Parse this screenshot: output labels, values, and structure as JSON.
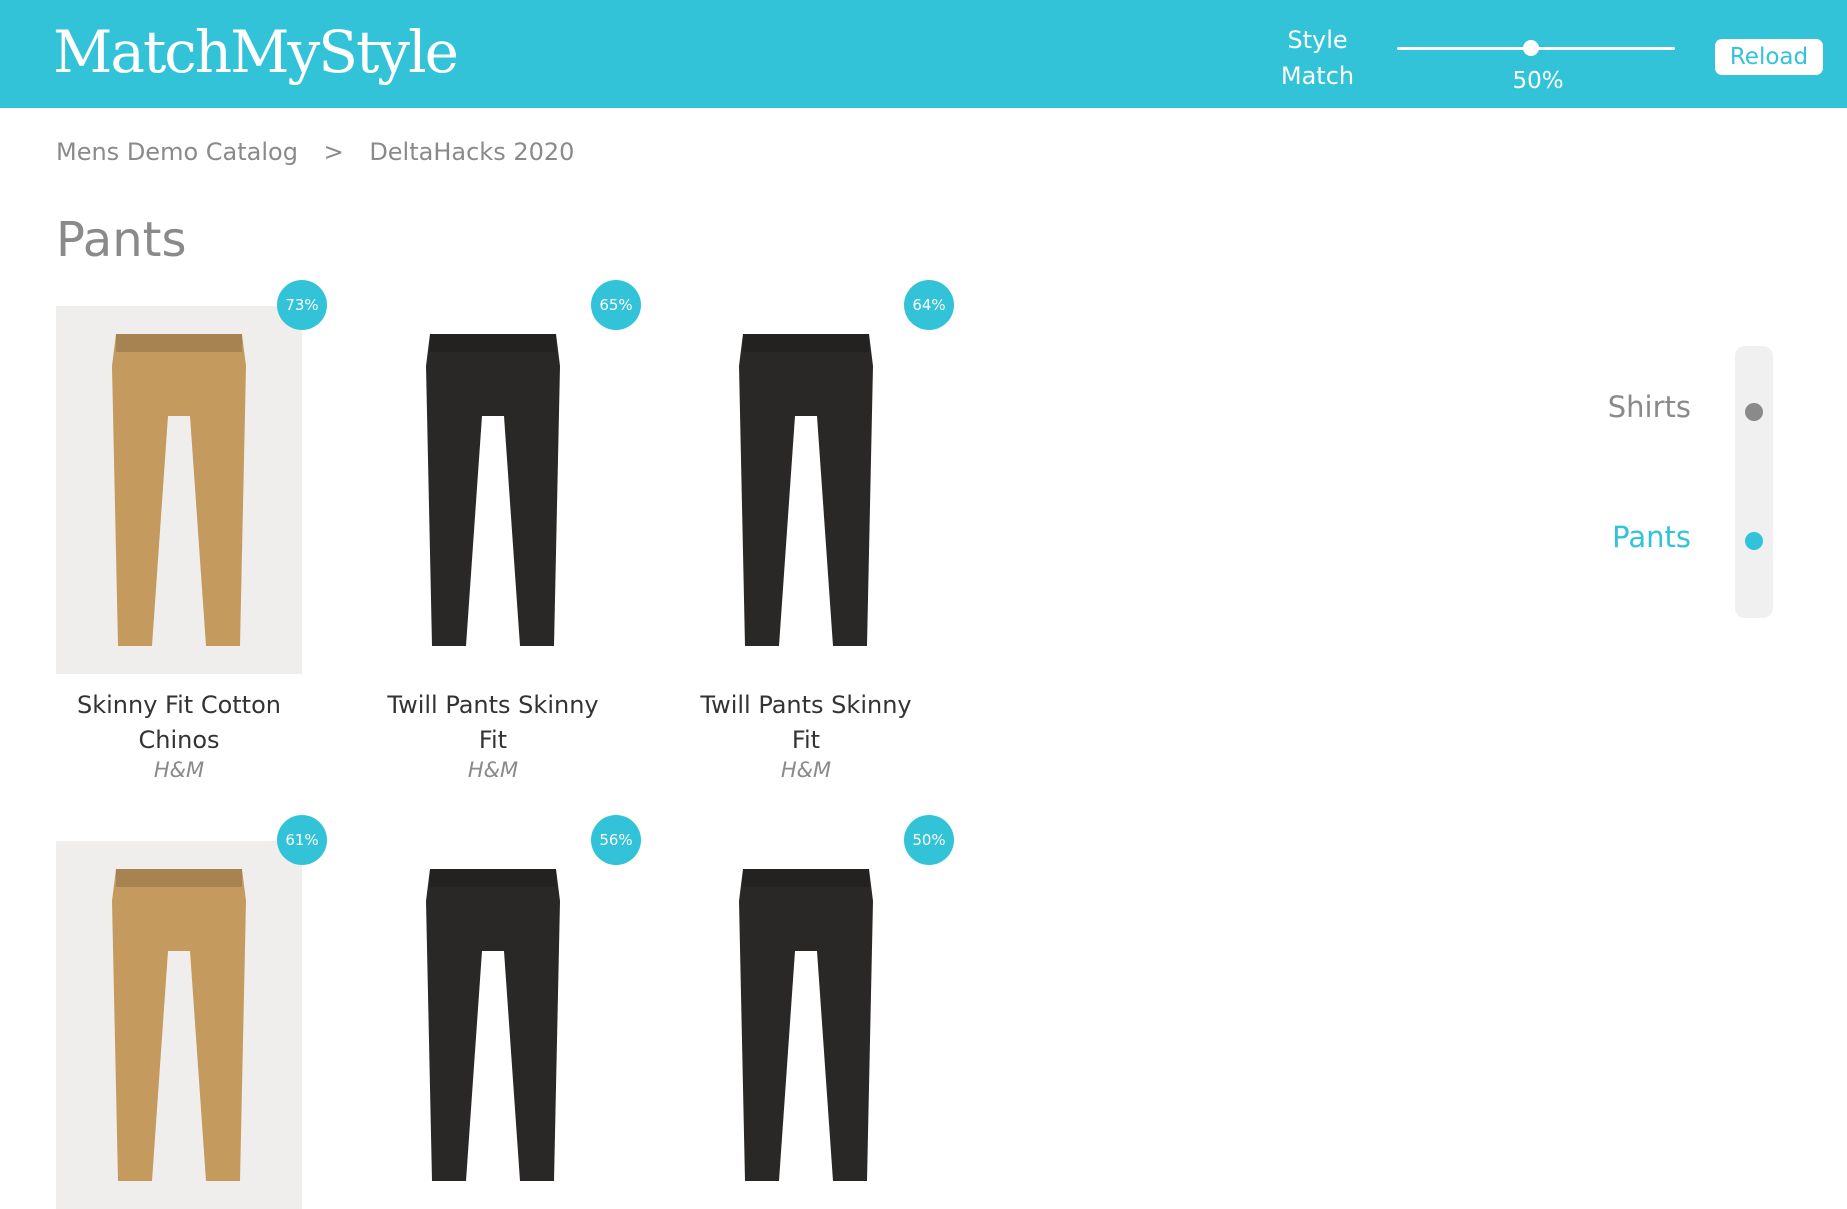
{
  "header": {
    "logo": "MatchMyStyle",
    "style_match_label": "Style Match",
    "slider_value": "50%",
    "slider_level_percent": 50,
    "reload_label": "Reload"
  },
  "breadcrumb": {
    "items": [
      "Mens Demo Catalog",
      "DeltaHacks 2020"
    ],
    "separator": ">"
  },
  "page_title": "Pants",
  "products": [
    {
      "name": "Skinny Fit Cotton Chinos",
      "brand": "H&M",
      "match": "73%",
      "color": "khaki"
    },
    {
      "name": "Twill Pants Skinny Fit",
      "brand": "H&M",
      "match": "65%",
      "color": "black"
    },
    {
      "name": "Twill Pants Skinny Fit",
      "brand": "H&M",
      "match": "64%",
      "color": "black"
    },
    {
      "name": "",
      "brand": "",
      "match": "61%",
      "color": "khaki"
    },
    {
      "name": "",
      "brand": "",
      "match": "56%",
      "color": "black"
    },
    {
      "name": "",
      "brand": "",
      "match": "50%",
      "color": "black"
    }
  ],
  "category_nav": [
    {
      "label": "Shirts",
      "active": false
    },
    {
      "label": "Pants",
      "active": true
    }
  ],
  "colors": {
    "accent": "#33c3d8",
    "inactive": "#8a8a8a",
    "khaki": "#c49a5e",
    "black": "#2a2827"
  }
}
